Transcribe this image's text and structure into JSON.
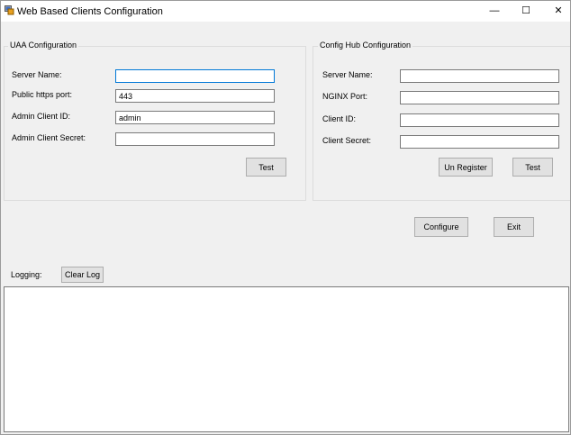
{
  "window": {
    "title": "Web Based Clients Configuration",
    "minimize_glyph": "—",
    "maximize_glyph": "☐",
    "close_glyph": "✕"
  },
  "uaa": {
    "group_title": "UAA Configuration",
    "server_name_label": "Server Name:",
    "server_name_value": "",
    "https_port_label": "Public https port:",
    "https_port_value": "443",
    "client_id_label": "Admin Client ID:",
    "client_id_value": "admin",
    "client_secret_label": "Admin Client Secret:",
    "client_secret_value": "",
    "test_label": "Test"
  },
  "confighub": {
    "group_title": "Config Hub Configuration",
    "server_name_label": "Server Name:",
    "server_name_value": "",
    "nginx_port_label": "NGINX Port:",
    "nginx_port_value": "",
    "client_id_label": "Client ID:",
    "client_id_value": "",
    "client_secret_label": "Client Secret:",
    "client_secret_value": "",
    "unregister_label": "Un Register",
    "test_label": "Test"
  },
  "actions": {
    "configure_label": "Configure",
    "exit_label": "Exit"
  },
  "logging": {
    "label": "Logging:",
    "clear_log_label": "Clear Log",
    "log_text": ""
  }
}
